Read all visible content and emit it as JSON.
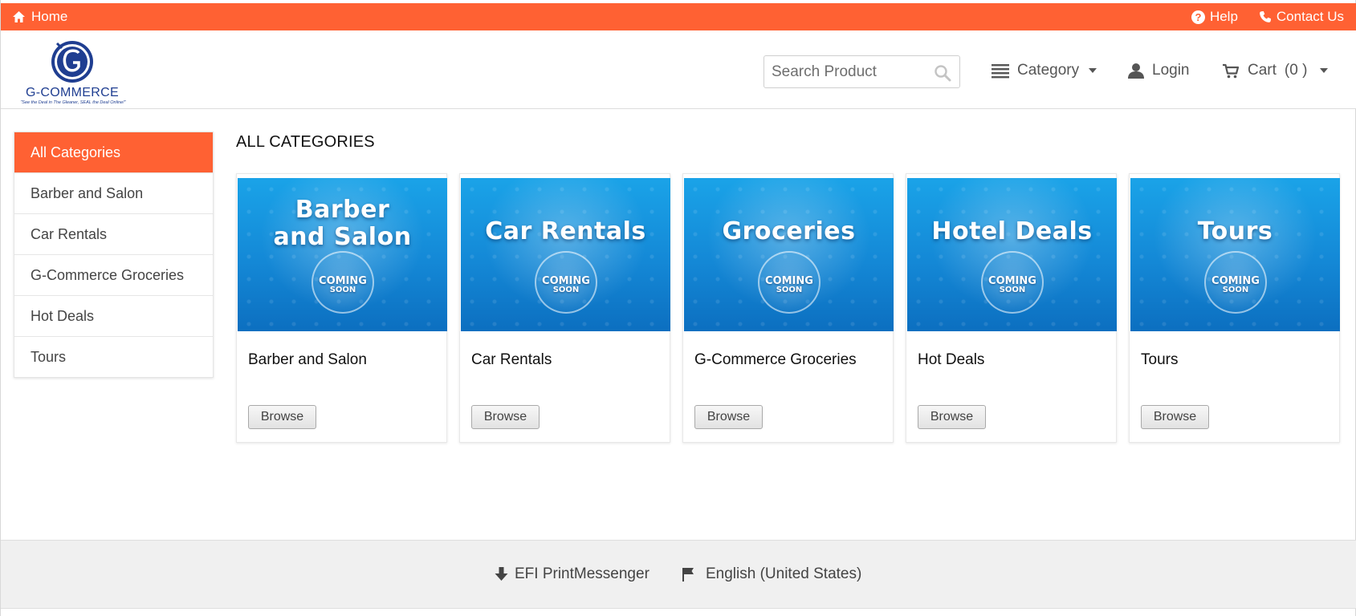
{
  "topbar": {
    "home": "Home",
    "help": "Help",
    "contact": "Contact Us",
    "home_icon": "home-icon",
    "help_icon": "question-circle-icon",
    "contact_icon": "phone-icon"
  },
  "logo": {
    "name": "G-COMMERCE",
    "tagline": "\"See the Deal in The Gleaner, SEAL the Deal Online!\""
  },
  "search": {
    "placeholder": "Search Product",
    "value": "",
    "icon": "search-icon"
  },
  "nav": {
    "category": "Category",
    "login": "Login",
    "cart": "Cart",
    "cart_count": "(0 )"
  },
  "sidebar": {
    "items": [
      {
        "label": "All Categories",
        "active": true
      },
      {
        "label": "Barber and Salon"
      },
      {
        "label": "Car Rentals"
      },
      {
        "label": "G-Commerce Groceries"
      },
      {
        "label": "Hot Deals"
      },
      {
        "label": "Tours"
      }
    ]
  },
  "main": {
    "title": "ALL CATEGORIES",
    "cards": [
      {
        "banner_line1": "Barber",
        "banner_line2": "and Salon",
        "name": "Barber and Salon",
        "button": "Browse",
        "coming1": "COMING",
        "coming2": "SOON"
      },
      {
        "banner_line1": "Car Rentals",
        "banner_line2": "",
        "name": "Car Rentals",
        "button": "Browse",
        "coming1": "COMING",
        "coming2": "SOON"
      },
      {
        "banner_line1": "Groceries",
        "banner_line2": "",
        "name": "G-Commerce Groceries",
        "button": "Browse",
        "coming1": "COMING",
        "coming2": "SOON"
      },
      {
        "banner_line1": "Hotel Deals",
        "banner_line2": "",
        "name": "Hot Deals",
        "button": "Browse",
        "coming1": "COMING",
        "coming2": "SOON"
      },
      {
        "banner_line1": "Tours",
        "banner_line2": "",
        "name": "Tours",
        "button": "Browse",
        "coming1": "COMING",
        "coming2": "SOON"
      }
    ]
  },
  "footer": {
    "download": "EFI PrintMessenger",
    "language": "English (United States)"
  },
  "colors": {
    "accent": "#ff6133",
    "banner_blue": "#1488d6",
    "logo_blue": "#1f3e91"
  }
}
